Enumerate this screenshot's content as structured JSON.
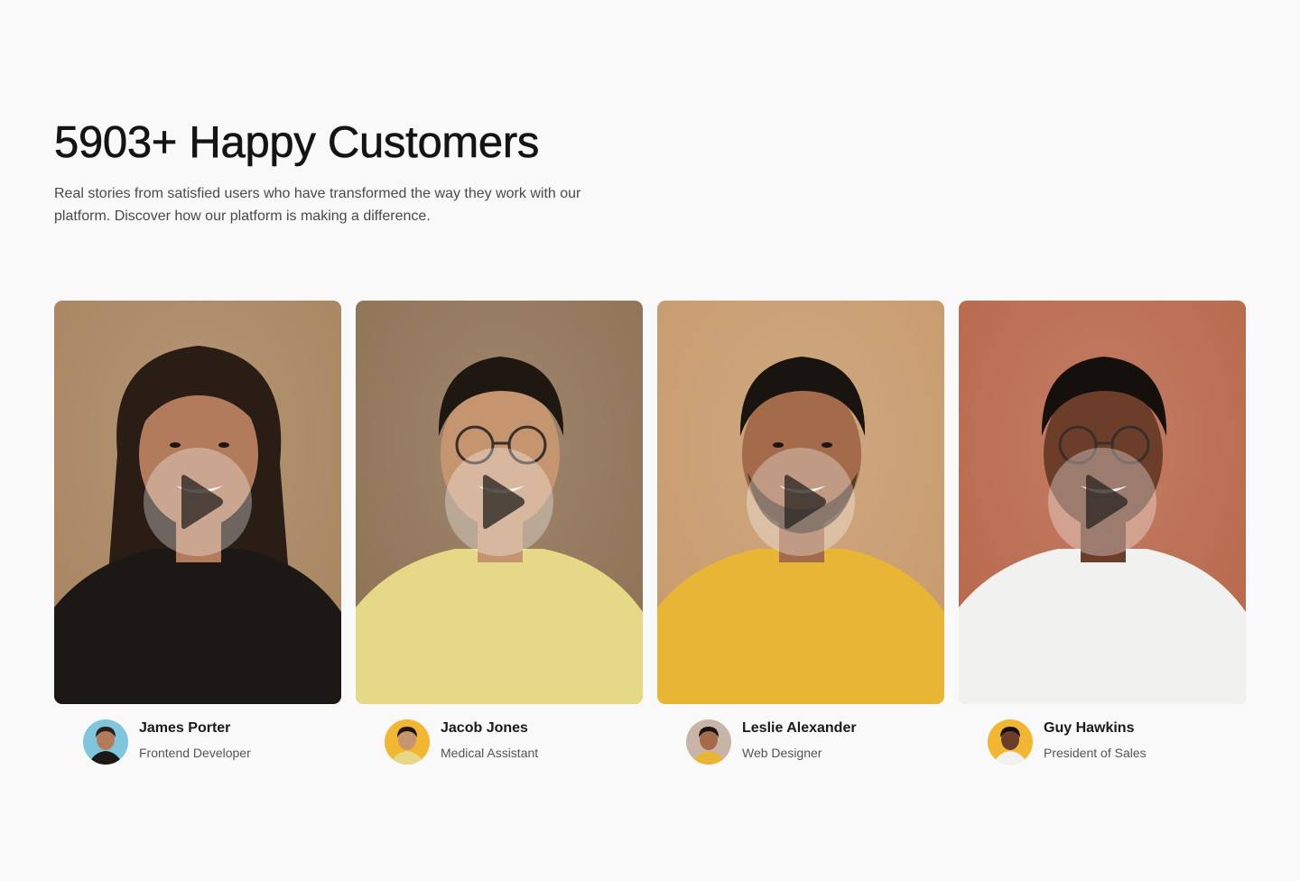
{
  "header": {
    "title": "5903+ Happy Customers",
    "description": "Real stories from satisfied users who have transformed the way they work with our platform. Discover how our platform is making a difference."
  },
  "testimonials": [
    {
      "name": "James Porter",
      "role": "Frontend Developer",
      "play_icon": "play-icon",
      "colors": {
        "background": "#a8845f",
        "shirt": "#1c1816",
        "skin": "#b27c5c",
        "hair": "#2a1d15",
        "avatar_bg": "#7fc6dd"
      }
    },
    {
      "name": "Jacob Jones",
      "role": "Medical Assistant",
      "play_icon": "play-icon",
      "colors": {
        "background": "#8e7154",
        "shirt": "#e5d886",
        "skin": "#c4956f",
        "hair": "#1f1712",
        "avatar_bg": "#f1b632"
      }
    },
    {
      "name": "Leslie Alexander",
      "role": "Web Designer",
      "play_icon": "play-icon",
      "colors": {
        "background": "#c79a6c",
        "shirt": "#e8b534",
        "skin": "#a46b4a",
        "hair": "#1a1410",
        "avatar_bg": "#c9b5a7"
      }
    },
    {
      "name": "Guy Hawkins",
      "role": "President of Sales",
      "play_icon": "play-icon",
      "colors": {
        "background": "#b8674a",
        "shirt": "#f1f1ef",
        "skin": "#6c3e2a",
        "hair": "#16100c",
        "avatar_bg": "#f1b632"
      }
    }
  ]
}
